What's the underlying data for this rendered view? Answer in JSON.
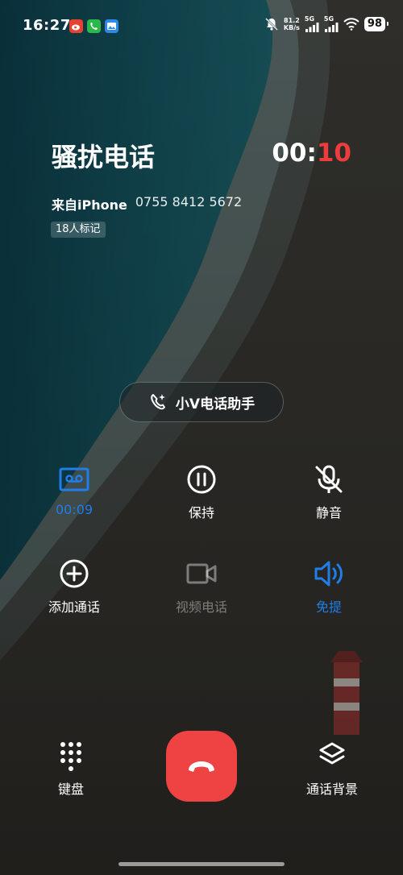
{
  "status_bar": {
    "time": "16:27",
    "net_speed_value": "81.2",
    "net_speed_unit": "KB/s",
    "signal1_gen": "5G",
    "signal2_gen": "5G",
    "battery": "98",
    "app_icons": [
      "weibo-icon",
      "phone-app-icon",
      "gallery-icon"
    ]
  },
  "call": {
    "title": "骚扰电话",
    "timer_min": "00:",
    "timer_sec": "10",
    "source": "来自iPhone",
    "number": "0755 8412 5672",
    "marks": "18人标记"
  },
  "assistant": {
    "label": "小V电话助手"
  },
  "controls": {
    "record": {
      "label": "00:09",
      "icon": "record-icon"
    },
    "hold": {
      "label": "保持",
      "icon": "pause-icon"
    },
    "mute": {
      "label": "静音",
      "icon": "mic-off-icon"
    },
    "add_call": {
      "label": "添加通话",
      "icon": "add-icon"
    },
    "video": {
      "label": "视频电话",
      "icon": "video-icon"
    },
    "speaker": {
      "label": "免提",
      "icon": "speaker-icon"
    },
    "keypad": {
      "label": "键盘",
      "icon": "keypad-icon"
    },
    "background": {
      "label": "通话背景",
      "icon": "layers-icon"
    }
  },
  "colors": {
    "accent_blue": "#1f7ee9",
    "end_call_red": "#ef4343",
    "timer_red": "#ec3c3c"
  }
}
